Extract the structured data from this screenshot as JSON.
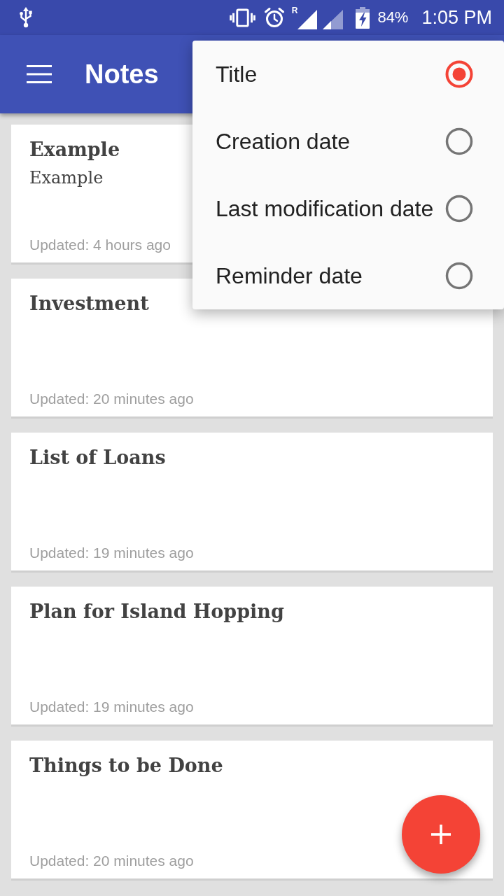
{
  "status_bar": {
    "roaming": "R",
    "battery": "84%",
    "time": "1:05 PM"
  },
  "app_bar": {
    "title": "Notes"
  },
  "notes": [
    {
      "title": "Example",
      "body": "Example",
      "updated": "Updated: 4 hours ago"
    },
    {
      "title": "Investment",
      "updated": "Updated: 20 minutes ago"
    },
    {
      "title": "List of Loans",
      "updated": "Updated: 19 minutes ago"
    },
    {
      "title": "Plan for Island Hopping",
      "updated": "Updated: 19 minutes ago"
    },
    {
      "title": "Things to be Done",
      "updated": "Updated: 20 minutes ago"
    }
  ],
  "sort_menu": {
    "options": [
      {
        "label": "Title",
        "selected": true
      },
      {
        "label": "Creation date",
        "selected": false
      },
      {
        "label": "Last modification date",
        "selected": false
      },
      {
        "label": "Reminder date",
        "selected": false
      }
    ]
  }
}
